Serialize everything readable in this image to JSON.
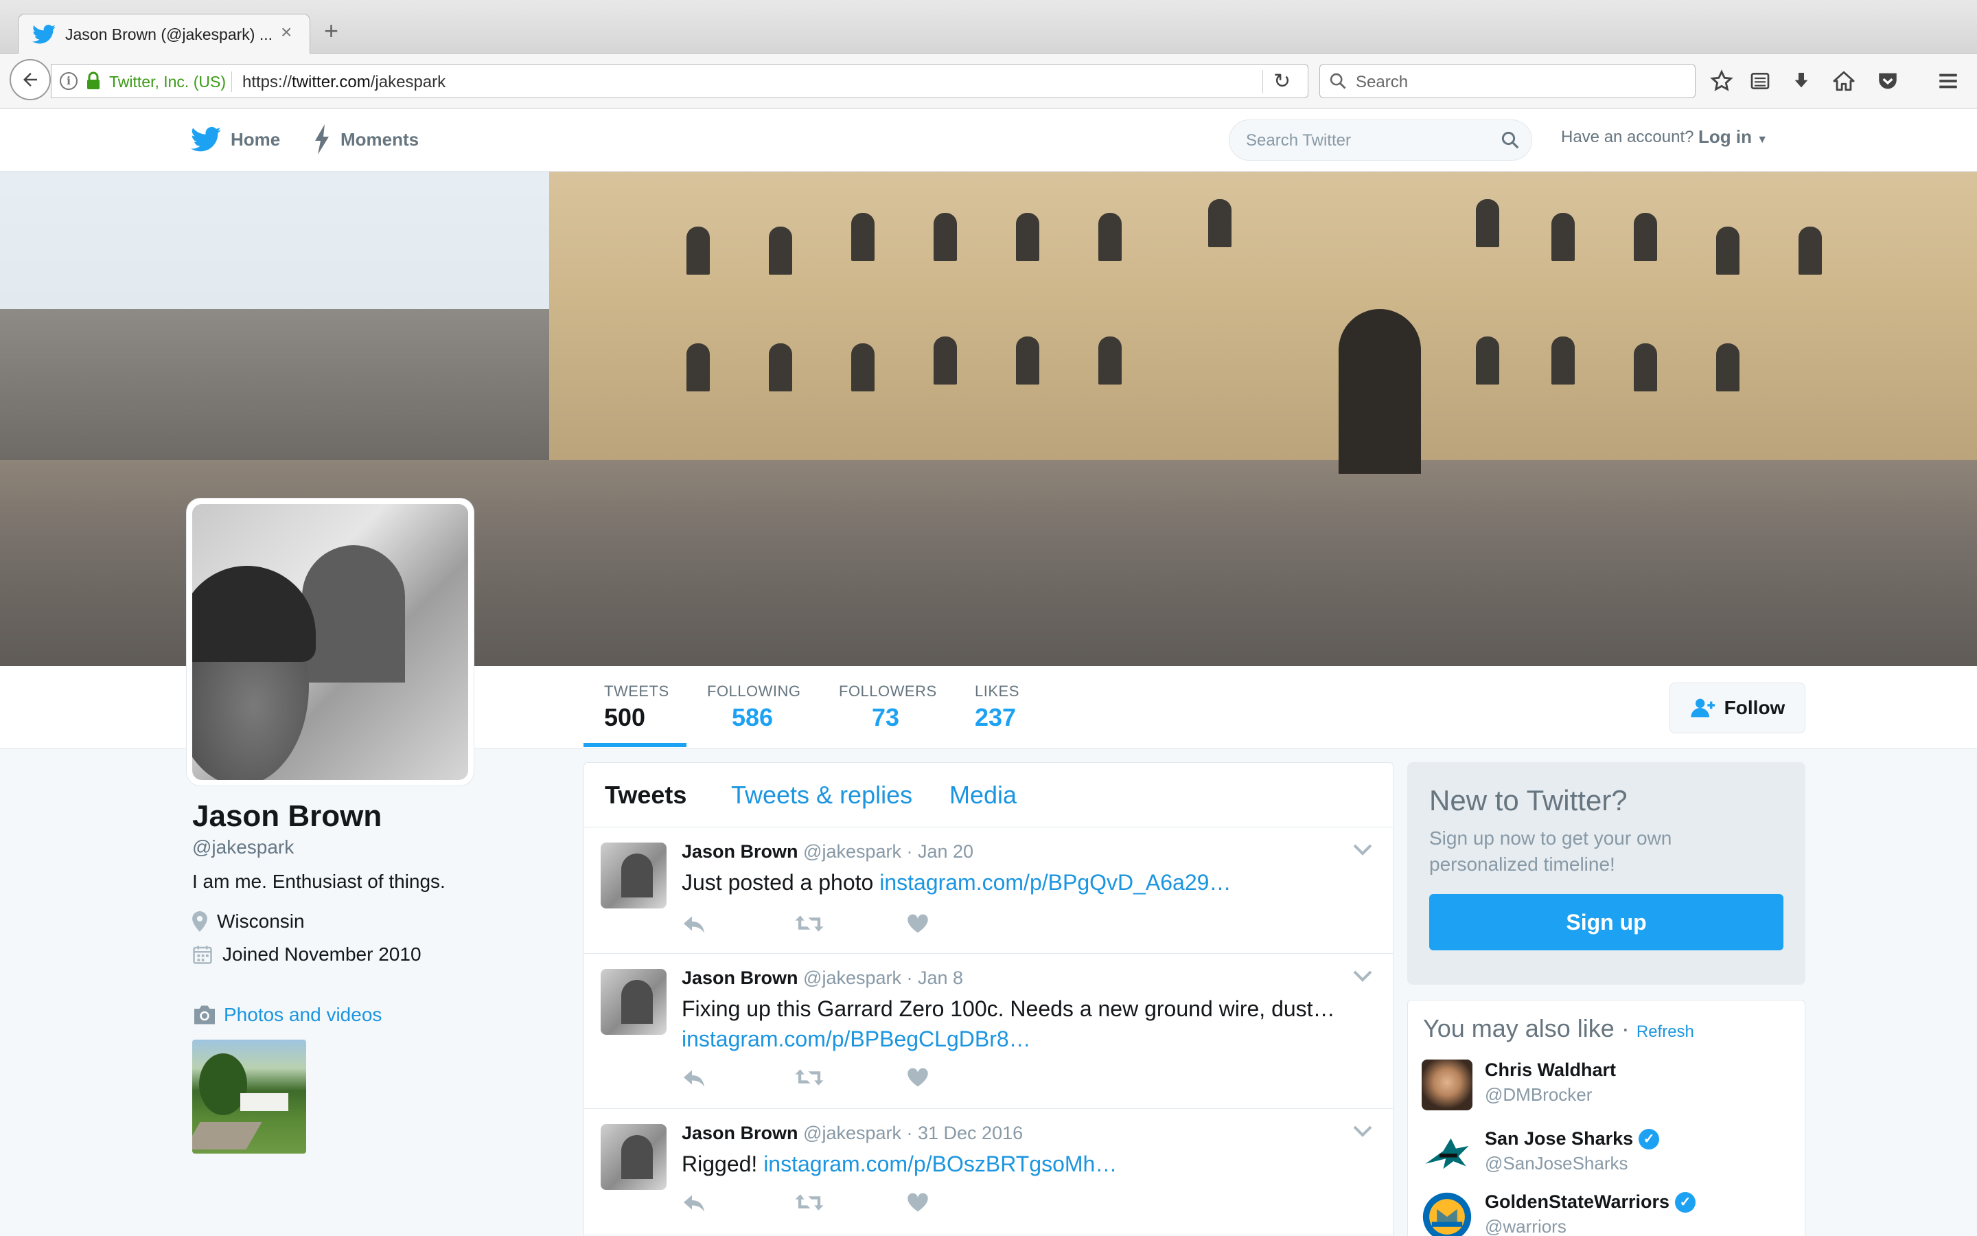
{
  "browser": {
    "tab_title": "Jason Brown (@jakespark) ...",
    "site_identity": "Twitter, Inc. (US)",
    "url_prefix": "https://",
    "url_domain": "twitter.com",
    "url_path": "/jakespark",
    "search_placeholder": "Search"
  },
  "topnav": {
    "home_label": "Home",
    "moments_label": "Moments",
    "search_placeholder": "Search Twitter",
    "have_account": "Have an account?",
    "login_label": "Log in"
  },
  "profile": {
    "name": "Jason Brown",
    "handle": "@jakespark",
    "bio": "I am me. Enthusiast of things.",
    "location": "Wisconsin",
    "joined": "Joined November 2010",
    "photos_label": "Photos and videos"
  },
  "stats": [
    {
      "label": "TWEETS",
      "value": "500"
    },
    {
      "label": "FOLLOWING",
      "value": "586"
    },
    {
      "label": "FOLLOWERS",
      "value": "73"
    },
    {
      "label": "LIKES",
      "value": "237"
    }
  ],
  "follow_label": "Follow",
  "timeline": {
    "tabs": [
      "Tweets",
      "Tweets & replies",
      "Media"
    ],
    "tweets": [
      {
        "name": "Jason Brown",
        "meta": "@jakespark · Jan 20",
        "text": "Just posted a photo ",
        "link": "instagram.com/p/BPgQvD_A6a29…"
      },
      {
        "name": "Jason Brown",
        "meta": "@jakespark · Jan 8",
        "text": "Fixing up this Garrard Zero 100c. Needs a new ground wire, dust…",
        "link": "instagram.com/p/BPBegCLgDBr8…"
      },
      {
        "name": "Jason Brown",
        "meta": "@jakespark · 31 Dec 2016",
        "text": "Rigged! ",
        "link": "instagram.com/p/BOszBRTgsoMh…"
      }
    ]
  },
  "signup": {
    "title": "New to Twitter?",
    "desc": "Sign up now to get your own personalized timeline!",
    "button": "Sign up"
  },
  "wtf": {
    "title": "You may also like",
    "separator": "·",
    "refresh": "Refresh",
    "users": [
      {
        "name": "Chris Waldhart",
        "handle": "@DMBrocker",
        "verified": false
      },
      {
        "name": "San Jose Sharks",
        "handle": "@SanJoseSharks",
        "verified": true
      },
      {
        "name": "GoldenStateWarriors",
        "handle": "@warriors",
        "verified": true
      }
    ]
  },
  "colors": {
    "twitter_blue": "#1da1f2",
    "link_blue": "#1b95e0",
    "secure_green": "#3b9a17"
  },
  "icons": [
    "twitter-bird-icon",
    "lightning-icon",
    "search-icon",
    "lock-icon",
    "info-icon",
    "reload-icon",
    "star-icon",
    "reading-list-icon",
    "download-icon",
    "home-icon",
    "pocket-icon",
    "hamburger-menu-icon",
    "location-pin-icon",
    "calendar-icon",
    "camera-icon",
    "reply-icon",
    "retweet-icon",
    "heart-icon",
    "chevron-down-icon",
    "add-user-icon",
    "verified-badge-icon"
  ]
}
